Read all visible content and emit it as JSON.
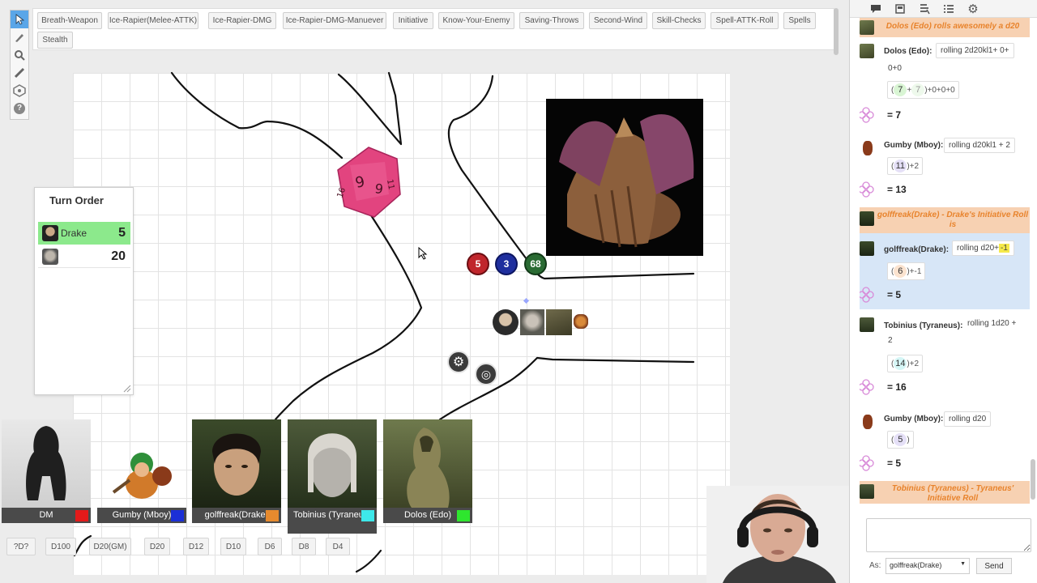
{
  "macros": {
    "row1": [
      "Breath-Weapon",
      "Ice-Rapier(Melee-ATTK)",
      "Ice-Rapier-DMG",
      "Ice-Rapier-DMG-Manuever",
      "Initiative",
      "Know-Your-Enemy",
      "Saving-Throws",
      "Second-Wind",
      "Skill-Checks",
      "Spell-ATTK-Roll",
      "Spells"
    ],
    "row2": [
      "Stealth"
    ]
  },
  "toolbar": [
    "select-icon",
    "brush-icon",
    "zoom-icon",
    "ruler-icon",
    "dice-icon",
    "help-icon"
  ],
  "turn_order": {
    "title": "Turn Order",
    "rows": [
      {
        "name": "Drake",
        "value": "5",
        "active": true
      },
      {
        "name": "",
        "value": "20",
        "active": false
      }
    ]
  },
  "map_badges": [
    {
      "value": "5",
      "color": "#c0262c"
    },
    {
      "value": "3",
      "color": "#1f2f9e"
    },
    {
      "value": "68",
      "color": "#2a6b33"
    }
  ],
  "players": [
    {
      "name": "DM",
      "color": "#e31a1a"
    },
    {
      "name": "Gumby (Mboy)",
      "color": "#1b2fd6"
    },
    {
      "name": "golffreak(Drake)",
      "color": "#e68a2e"
    },
    {
      "name": "Tobinius (Tyraneus)",
      "color": "#3ee8ea"
    },
    {
      "name": "Dolos (Edo)",
      "color": "#2ee62e"
    }
  ],
  "dice_buttons": [
    "?D?",
    "D100",
    "D20(GM)",
    "D20",
    "D12",
    "D10",
    "D6",
    "D8",
    "D4"
  ],
  "chat": {
    "tabs": [
      "chat-icon",
      "journal-icon",
      "compendium-icon",
      "list-icon",
      "settings-icon"
    ],
    "m1": {
      "emote": "Dolos (Edo) rolls awesomely a d20"
    },
    "m2": {
      "who": "Dolos (Edo):",
      "formula": "rolling 2d20kl1+ 0+",
      "formula2": "0+0",
      "d1": "7",
      "plus": "+",
      "d2": "7",
      "tail": ")+0+0+0",
      "result": "= 7"
    },
    "m3": {
      "who": "Gumby (Mboy):",
      "formula": "rolling d20kl1 + 2",
      "d1": "11",
      "tail": ")+2",
      "result": "= 13"
    },
    "m4": {
      "emote": "golffreak(Drake) - Drake's Initiative Roll is"
    },
    "m5": {
      "who": "golffreak(Drake):",
      "formula": "rolling d20+",
      "mod": "-1",
      "d1": "6",
      "tail": ")+-1",
      "result": "= 5"
    },
    "m6": {
      "who": "Tobinius (Tyraneus):",
      "formula": "rolling 1d20 +",
      "formula2": "2",
      "d1": "14",
      "tail": ")+2",
      "result": "= 16"
    },
    "m7": {
      "who": "Gumby (Mboy):",
      "formula": "rolling d20",
      "d1": "5",
      "tail": ")",
      "result": "= 5"
    },
    "m8": {
      "emote": "Tobinius (Tyraneus) - Tyraneus' Initiative Roll"
    },
    "as_label": "As:",
    "as_value": "golffreak(Drake)",
    "send": "Send"
  },
  "colors": {
    "active_turn": "#8ce98c",
    "emote_bg": "#f7d1b2",
    "emote_text": "#e8832c",
    "chat_highlight": "#d7e6f7"
  }
}
